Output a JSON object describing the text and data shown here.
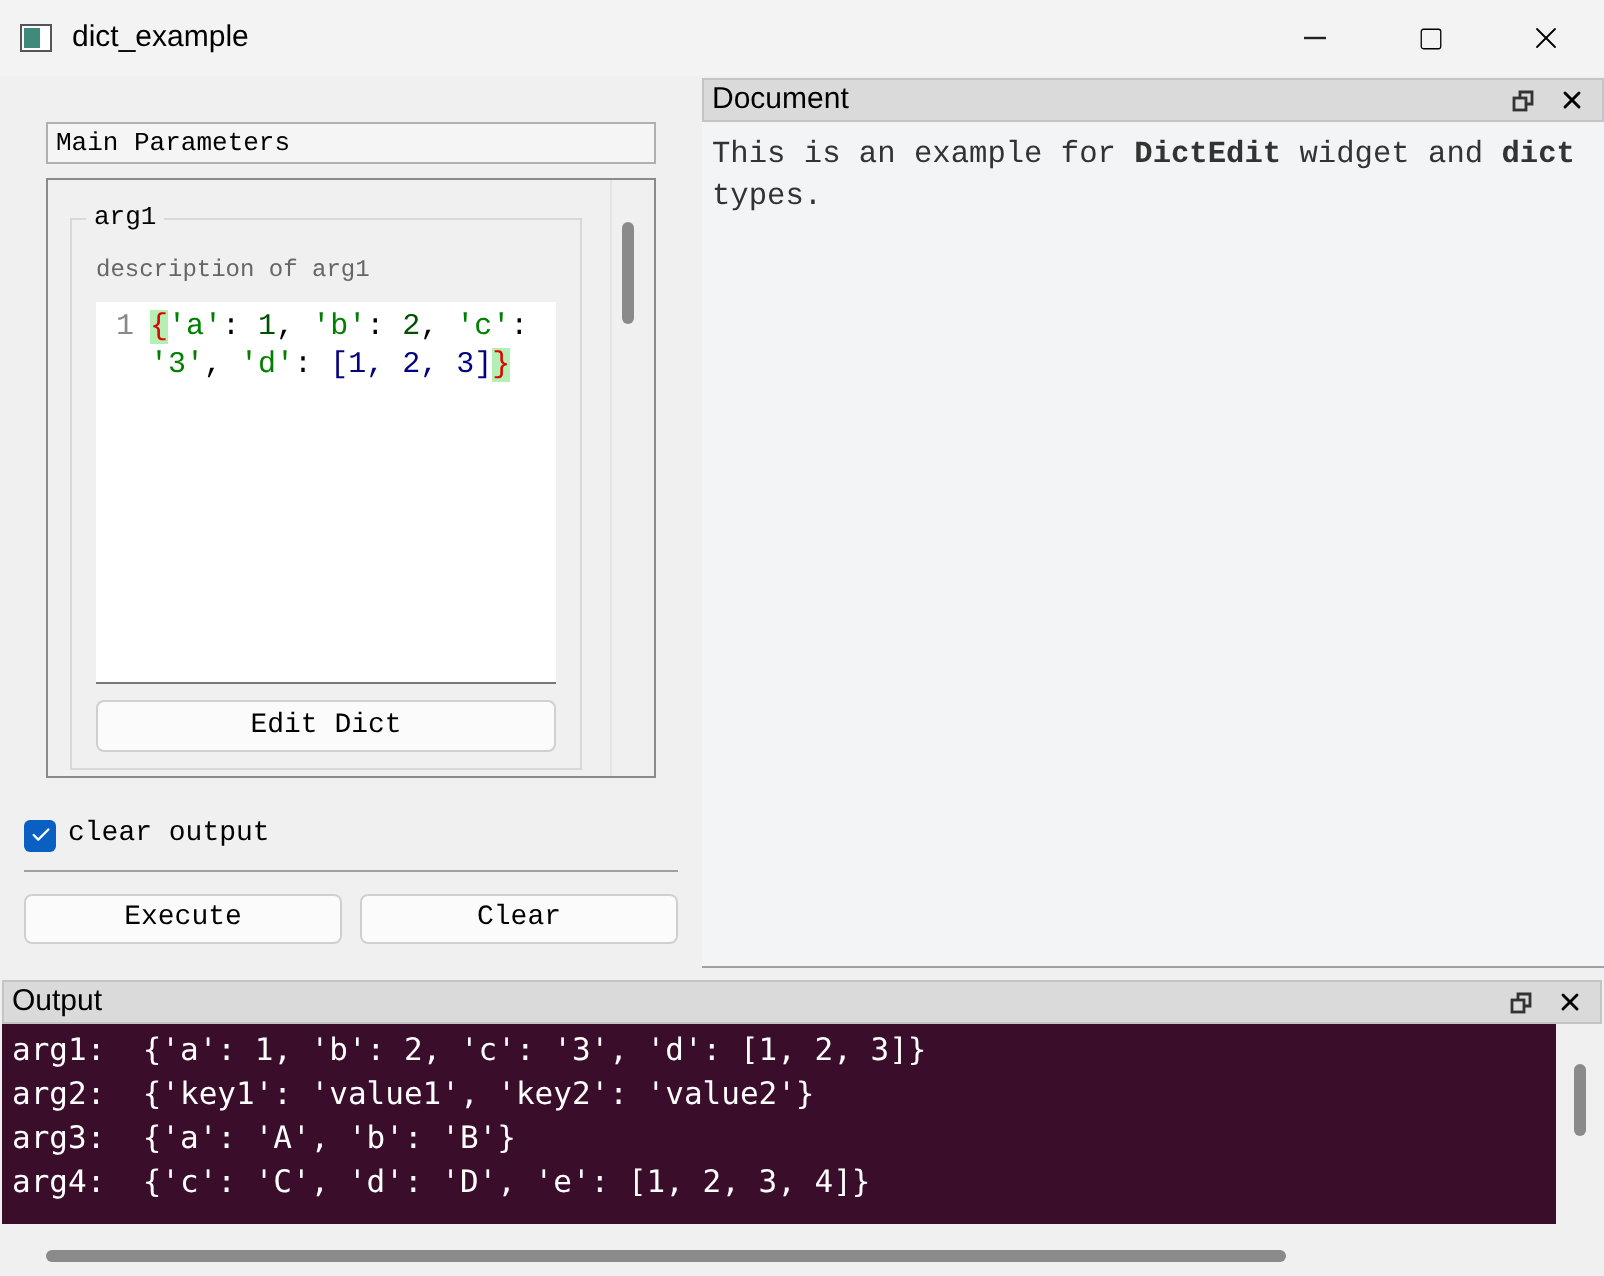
{
  "window": {
    "title": "dict_example"
  },
  "parameters": {
    "header": "Main Parameters",
    "group": {
      "title": "arg1",
      "description": "description of arg1",
      "editor": {
        "lines": [
          {
            "number": "1",
            "tokens": [
              {
                "kind": "match",
                "text": "{"
              },
              {
                "kind": "string",
                "text": "'a'"
              },
              {
                "kind": "punct",
                "text": ": "
              },
              {
                "kind": "number",
                "text": "1"
              },
              {
                "kind": "punct",
                "text": ", "
              },
              {
                "kind": "string",
                "text": "'b'"
              },
              {
                "kind": "punct",
                "text": ": "
              },
              {
                "kind": "number",
                "text": "2"
              },
              {
                "kind": "punct",
                "text": ", "
              },
              {
                "kind": "string",
                "text": "'c'"
              },
              {
                "kind": "punct",
                "text": ": "
              },
              {
                "kind": "string",
                "text": "'3'"
              },
              {
                "kind": "punct",
                "text": ", "
              },
              {
                "kind": "string",
                "text": "'d'"
              },
              {
                "kind": "punct",
                "text": ": "
              },
              {
                "kind": "bracket",
                "text": "[1, 2, 3]"
              },
              {
                "kind": "match",
                "text": "}"
              }
            ]
          }
        ]
      },
      "button": "Edit Dict"
    }
  },
  "clear_output": {
    "label": "clear output",
    "checked": true
  },
  "buttons": [
    "Execute",
    "Clear"
  ],
  "document": {
    "title": "Document",
    "text": "This is an example for **DictEdit** widget and **dict** types."
  },
  "output": {
    "title": "Output",
    "lines": [
      "arg1:  {'a': 1, 'b': 2, 'c': '3', 'd': [1, 2, 3]}",
      "arg2:  {'key1': 'value1', 'key2': 'value2'}",
      "arg3:  {'a': 'A', 'b': 'B'}",
      "arg4:  {'c': 'C', 'd': 'D', 'e': [1, 2, 3, 4]}"
    ]
  }
}
